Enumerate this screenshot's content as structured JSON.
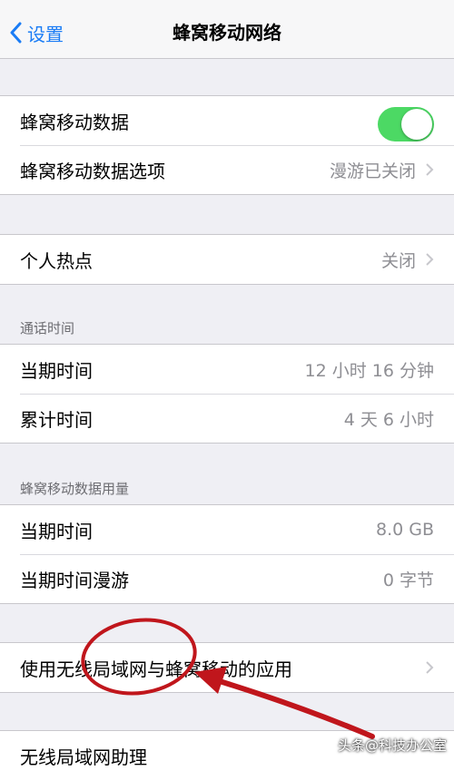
{
  "nav": {
    "back_label": "设置",
    "title": "蜂窝移动网络"
  },
  "group1": {
    "cellular_data_label": "蜂窝移动数据",
    "cellular_data_on": true,
    "cellular_options_label": "蜂窝移动数据选项",
    "cellular_options_value": "漫游已关闭"
  },
  "group2": {
    "hotspot_label": "个人热点",
    "hotspot_value": "关闭"
  },
  "call_time": {
    "header": "通话时间",
    "current_label": "当期时间",
    "current_value": "12 小时 16 分钟",
    "lifetime_label": "累计时间",
    "lifetime_value": "4 天 6 小时"
  },
  "data_usage": {
    "header": "蜂窝移动数据用量",
    "current_label": "当期时间",
    "current_value": "8.0 GB",
    "roaming_label": "当期时间漫游",
    "roaming_value": "0 字节"
  },
  "apps": {
    "label": "使用无线局域网与蜂窝移动的应用"
  },
  "wifi_assist": {
    "label": "无线局域网助理"
  },
  "watermark": "头条@科技办公室",
  "colors": {
    "accent": "#1a7cf5",
    "toggle_on": "#4cd964",
    "annotation": "#c0161c"
  }
}
